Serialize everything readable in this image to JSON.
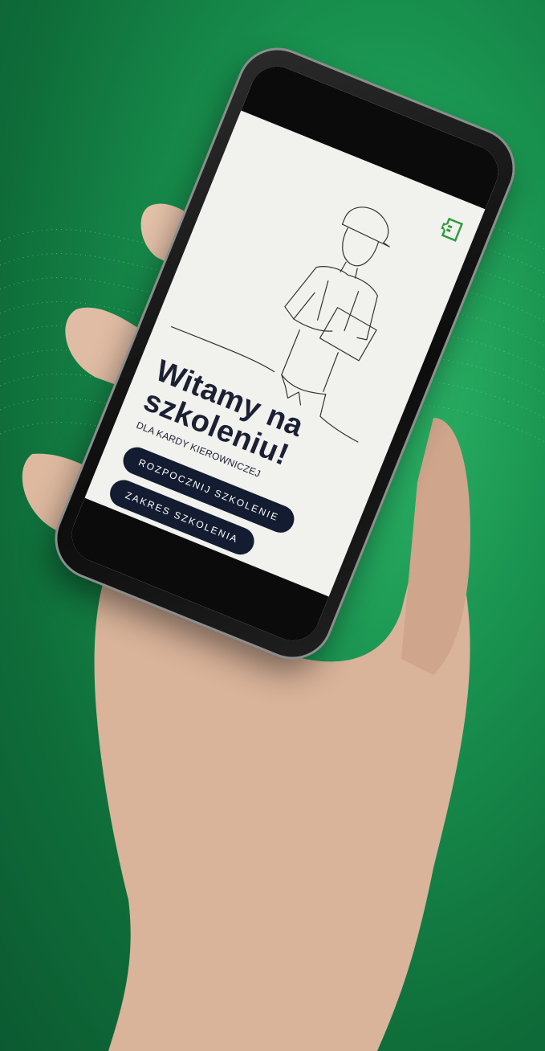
{
  "colors": {
    "background": "#17904e",
    "screen_bg": "#f1f1ee",
    "title_color": "#1b2033",
    "button_bg": "#131c30",
    "button_text": "#ffffff",
    "exit_icon_color": "#2e9b3e"
  },
  "screen": {
    "exit_icon": "exit-icon",
    "illustration": "worker-with-clipboard-line-drawing",
    "title_line1": "Witamy na",
    "title_line2": "szkoleniu!",
    "subtitle": "DLA KARDY KIEROWNICZEJ",
    "buttons": {
      "start": "ROZPOCZNIJ SZKOLENIE",
      "scope": "ZAKRES SZKOLENIA"
    }
  }
}
